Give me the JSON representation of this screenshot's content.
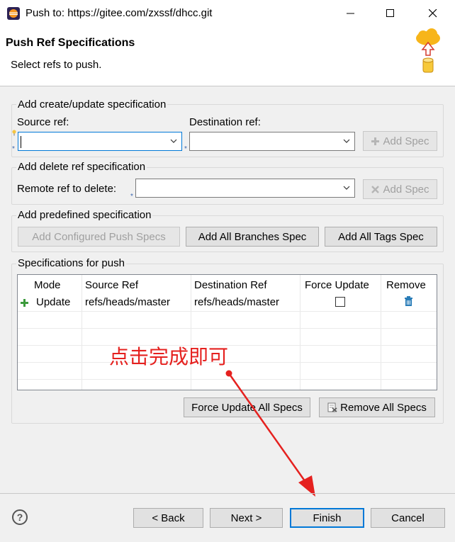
{
  "window": {
    "title": "Push to: https://gitee.com/zxssf/dhcc.git",
    "minimize": "—",
    "maximize": "☐",
    "close": "✕"
  },
  "header": {
    "title": "Push Ref Specifications",
    "description": "Select refs to push."
  },
  "create_group": {
    "title": "Add create/update specification",
    "source_label": "Source ref:",
    "source_value": "",
    "dest_label": "Destination ref:",
    "dest_value": "",
    "add_spec": "Add Spec"
  },
  "delete_group": {
    "title": "Add delete ref specification",
    "remote_label": "Remote ref to delete:",
    "remote_value": "",
    "add_spec": "Add Spec"
  },
  "predefined_group": {
    "title": "Add predefined specification",
    "configured": "Add Configured Push Specs",
    "branches": "Add All Branches Spec",
    "tags": "Add All Tags Spec"
  },
  "specs_group": {
    "title": "Specifications for push",
    "columns": [
      "Mode",
      "Source Ref",
      "Destination Ref",
      "Force Update",
      "Remove"
    ],
    "rows": [
      {
        "mode": "Update",
        "source": "refs/heads/master",
        "destination": "refs/heads/master",
        "force_update": false
      }
    ],
    "force_update_all": "Force Update All Specs",
    "remove_all": "Remove All Specs"
  },
  "annotation": {
    "text": "点击完成即可",
    "color": "#e5211f"
  },
  "footer": {
    "help": "?",
    "back": "< Back",
    "next": "Next >",
    "finish": "Finish",
    "cancel": "Cancel"
  },
  "colors": {
    "accent": "#0078d7",
    "add_icon": "#3c9a3c",
    "remove_icon": "#2a7db8"
  }
}
